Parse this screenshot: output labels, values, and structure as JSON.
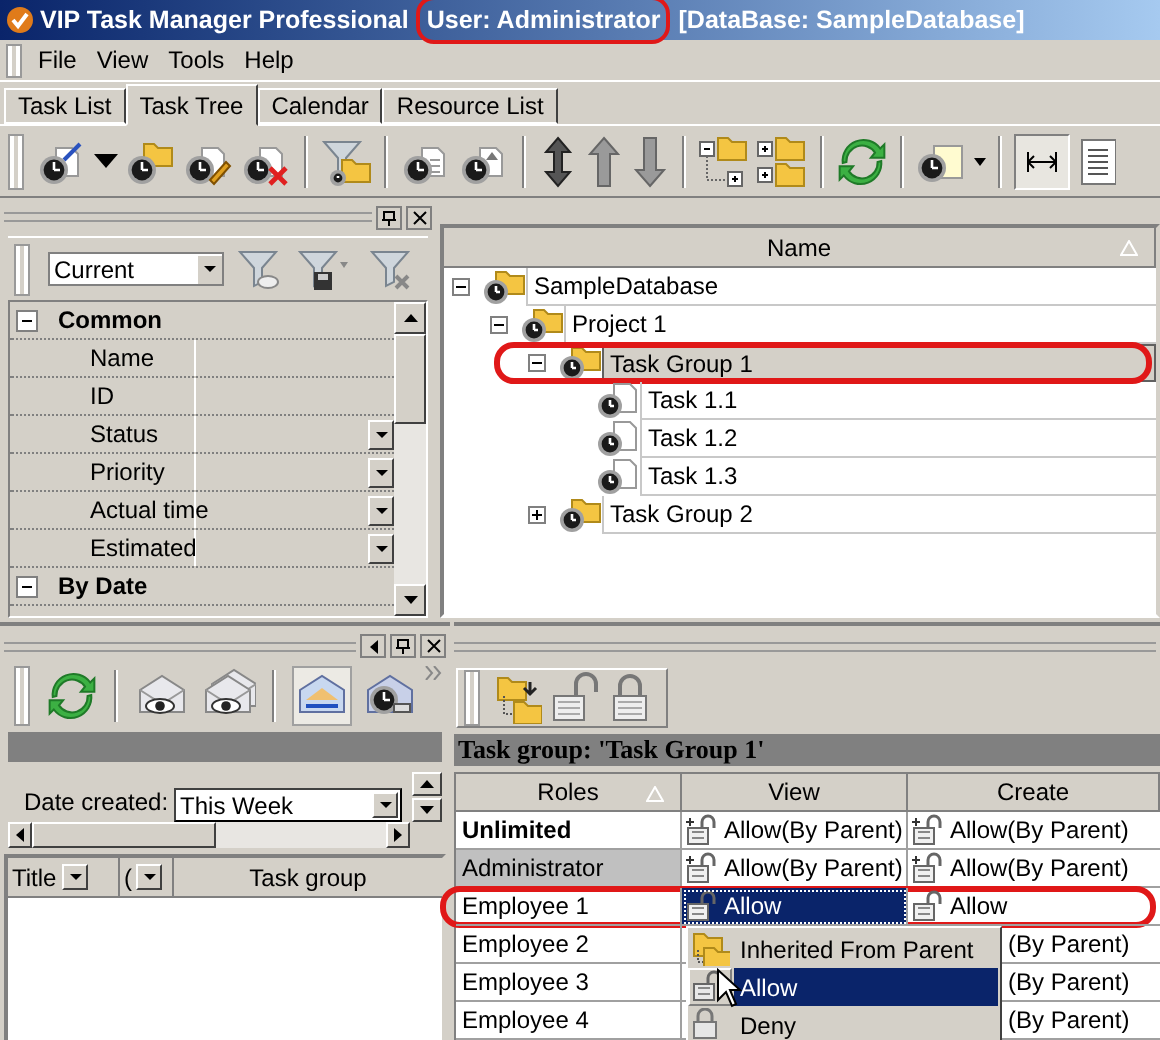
{
  "window": {
    "title": "VIP Task Manager Professional",
    "user": "User: Administrator",
    "database": "[DataBase: SampleDatabase]",
    "user_highlighted": true
  },
  "menu": [
    "File",
    "View",
    "Tools",
    "Help"
  ],
  "tabs": [
    {
      "label": "Task List",
      "selected": false
    },
    {
      "label": "Task Tree",
      "selected": true
    },
    {
      "label": "Calendar",
      "selected": false
    },
    {
      "label": "Resource List",
      "selected": false
    }
  ],
  "filter_panel": {
    "filter": "Current",
    "groups": [
      {
        "label": "Common",
        "expanded": true,
        "properties": [
          {
            "name": "Name",
            "kind": "text"
          },
          {
            "name": "ID",
            "kind": "text"
          },
          {
            "name": "Status",
            "kind": "dropdown"
          },
          {
            "name": "Priority",
            "kind": "dropdown"
          },
          {
            "name": "Actual time",
            "kind": "dropdown"
          },
          {
            "name": "Estimated",
            "kind": "dropdown"
          }
        ]
      },
      {
        "label": "By Date",
        "expanded": true
      }
    ]
  },
  "tree": {
    "column": "Name",
    "items": [
      {
        "label": "SampleDatabase",
        "kind": "folder",
        "expanded": true,
        "selected": false,
        "highlighted": false,
        "children": [
          {
            "label": "Project 1",
            "kind": "folder",
            "expanded": true,
            "selected": false,
            "highlighted": false,
            "children": [
              {
                "label": "Task Group 1",
                "kind": "folder",
                "expanded": true,
                "selected": true,
                "highlighted": true,
                "children": [
                  {
                    "label": "Task 1.1",
                    "kind": "task",
                    "selected": false,
                    "highlighted": false
                  },
                  {
                    "label": "Task 1.2",
                    "kind": "task",
                    "selected": false,
                    "highlighted": false
                  },
                  {
                    "label": "Task 1.3",
                    "kind": "task",
                    "selected": false,
                    "highlighted": false
                  }
                ]
              },
              {
                "label": "Task Group 2",
                "kind": "folder",
                "expanded": false,
                "selected": false,
                "highlighted": false
              }
            ]
          }
        ]
      }
    ]
  },
  "messages_panel": {
    "date_label": "Date created:",
    "date_value": "This Week",
    "columns": [
      "Title",
      "(",
      "Task group"
    ]
  },
  "permissions": {
    "title": "Task group: 'Task Group 1'",
    "columns": [
      "Roles",
      "View",
      "Create"
    ],
    "rows": [
      {
        "role": "Unlimited",
        "kind": "unlimited",
        "highlighted": false,
        "view": {
          "text": "Allow(By Parent)",
          "kind": "inherited",
          "selected": false
        },
        "create": {
          "text": "Allow(By Parent)",
          "kind": "inherited"
        }
      },
      {
        "role": "Administrator",
        "kind": "admin",
        "highlighted": false,
        "view": {
          "text": "Allow(By Parent)",
          "kind": "inherited",
          "selected": false
        },
        "create": {
          "text": "Allow(By Parent)",
          "kind": "inherited"
        }
      },
      {
        "role": "Employee 1",
        "kind": "role",
        "highlighted": true,
        "view": {
          "text": "Allow",
          "kind": "allow",
          "selected": true
        },
        "create": {
          "text": "Allow",
          "kind": "allow"
        }
      },
      {
        "role": "Employee 2",
        "kind": "role",
        "highlighted": false,
        "create": {
          "text": "(By Parent)",
          "kind": "covered"
        }
      },
      {
        "role": "Employee 3",
        "kind": "role",
        "highlighted": false,
        "create": {
          "text": "(By Parent)",
          "kind": "covered"
        }
      },
      {
        "role": "Employee 4",
        "kind": "role",
        "highlighted": false,
        "create": {
          "text": "(By Parent)",
          "kind": "covered"
        }
      }
    ]
  },
  "dropdown": {
    "items": [
      {
        "label": "Inherited From Parent",
        "kind": "inherited",
        "selected": false
      },
      {
        "label": "Allow",
        "kind": "allow",
        "selected": true
      },
      {
        "label": "Deny",
        "kind": "deny",
        "selected": false
      }
    ]
  }
}
